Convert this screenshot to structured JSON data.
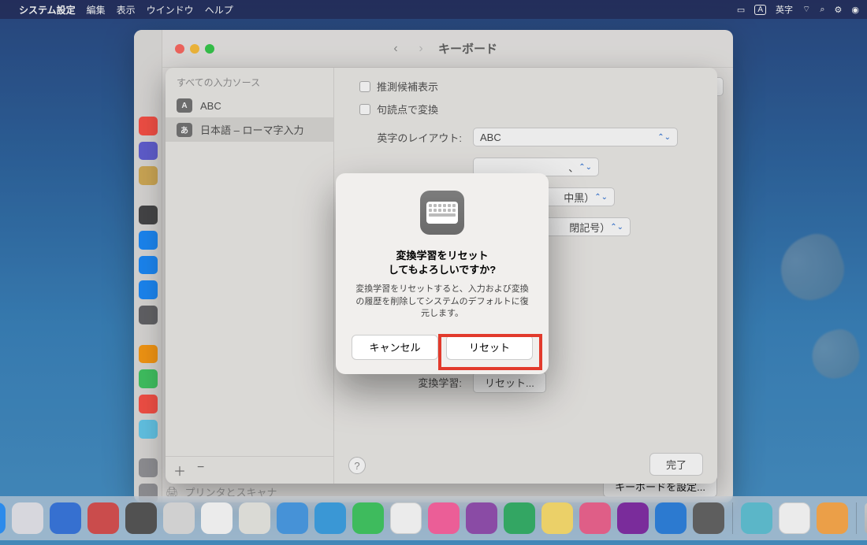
{
  "menubar": {
    "app": "システム設定",
    "items": [
      "編集",
      "表示",
      "ウインドウ",
      "ヘルプ"
    ],
    "ime": "A",
    "ime_label": "英字"
  },
  "settings": {
    "title": "キーボード",
    "search_placeholder": "",
    "sidebar_all_sources": "すべての入力ソース",
    "printer": "プリンタとスキャナ",
    "set_keyboard": "キーボードを設定...",
    "done": "完了"
  },
  "ime": {
    "title": "すべての入力ソース",
    "items": [
      {
        "badge": "A",
        "badge_bg": "#6a6a6a",
        "label": "ABC"
      },
      {
        "badge": "あ",
        "badge_bg": "#6a6a6a",
        "label": "日本語 – ローマ字入力"
      }
    ],
    "checkboxes": {
      "candidates": "推測候補表示",
      "punct_convert": "句読点で変換"
    },
    "layout_label": "英字のレイアウト:",
    "layout_value": "ABC",
    "partial_rows": [
      {
        "value": "、"
      },
      {
        "value": "中黒）"
      },
      {
        "value": "閉記号）"
      }
    ],
    "reset_label": "変換学習:",
    "reset_btn": "リセット..."
  },
  "modal": {
    "title_l1": "変換学習をリセット",
    "title_l2": "してもよろしいですか?",
    "body": "変換学習をリセットすると、入力および変換の履歴を削除してシステムのデフォルトに復元します。",
    "cancel": "キャンセル",
    "confirm": "リセット"
  },
  "dock": {
    "apps": [
      "#1f8fff",
      "#e8e8ef",
      "#2b6fe0",
      "#d94545",
      "#4a4a4a",
      "#e0e0e0",
      "#ffffff",
      "#ecece6",
      "#3e97e8",
      "#2f9de6",
      "#34c759",
      "#ff3b30",
      "#2196f3",
      "#8e44ad",
      "#27ae60",
      "#f15a8a",
      "#7b1fa2",
      "#1f7be0",
      "#5a5a5a",
      "#e0e0e0",
      "#56c1d6",
      "#ffffff",
      "#ffa640"
    ]
  }
}
